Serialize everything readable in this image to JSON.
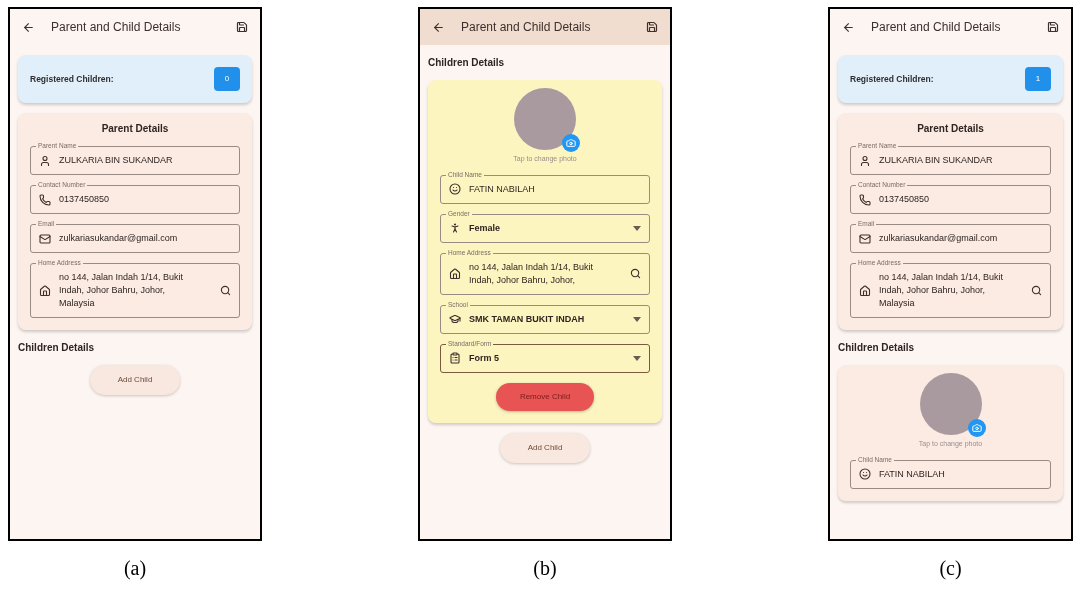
{
  "panels": [
    {
      "caption": "(a)",
      "app_bar": {
        "title": "Parent and Child Details",
        "tinted": false
      },
      "blocks": [
        {
          "kind": "registered",
          "label": "Registered Children:",
          "count": "0"
        },
        {
          "kind": "parent_card",
          "heading": "Parent Details",
          "fields": [
            {
              "kind": "person",
              "label": "Parent Name",
              "value": "ZULKARIA BIN SUKANDAR"
            },
            {
              "kind": "phone",
              "label": "Contact Number",
              "value": "0137450850"
            },
            {
              "kind": "email",
              "label": "Email",
              "value": "zulkariasukandar@gmail.com"
            },
            {
              "kind": "address",
              "label": "Home Address",
              "value": "no 144, Jalan Indah 1/14, Bukit Indah, Johor Bahru, Johor, Malaysia"
            }
          ]
        },
        {
          "kind": "heading",
          "text": "Children Details"
        },
        {
          "kind": "add_button",
          "text": "Add Child"
        }
      ]
    },
    {
      "caption": "(b)",
      "app_bar": {
        "title": "Parent and Child Details",
        "tinted": true
      },
      "blocks": [
        {
          "kind": "heading",
          "text": "Children Details"
        },
        {
          "kind": "child_card",
          "highlighted": true,
          "photo_hint": "Tap to change photo",
          "fields": [
            {
              "kind": "child",
              "label": "Child Name",
              "value": "FATIN NABILAH"
            },
            {
              "kind": "gender",
              "label": "Gender",
              "value": "Female"
            },
            {
              "kind": "address",
              "label": "Home Address",
              "value": "no 144, Jalan Indah 1/14, Bukit Indah, Johor Bahru, Johor,"
            },
            {
              "kind": "school",
              "label": "School",
              "value": "SMK TAMAN BUKIT INDAH"
            },
            {
              "kind": "grade",
              "label": "Standard/Form",
              "value": "Form 5",
              "focused": true
            }
          ],
          "remove_button": "Remove Child"
        },
        {
          "kind": "add_button",
          "text": "Add Child"
        }
      ]
    },
    {
      "caption": "(c)",
      "app_bar": {
        "title": "Parent and Child Details",
        "tinted": false
      },
      "blocks": [
        {
          "kind": "registered",
          "label": "Registered Children:",
          "count": "1"
        },
        {
          "kind": "parent_card",
          "heading": "Parent Details",
          "fields": [
            {
              "kind": "person",
              "label": "Parent Name",
              "value": "ZULKARIA BIN SUKANDAR"
            },
            {
              "kind": "phone",
              "label": "Contact Number",
              "value": "0137450850"
            },
            {
              "kind": "email",
              "label": "Email",
              "value": "zulkariasukandar@gmail.com"
            },
            {
              "kind": "address",
              "label": "Home Address",
              "value": "no 144, Jalan Indah 1/14, Bukit Indah, Johor Bahru, Johor, Malaysia"
            }
          ]
        },
        {
          "kind": "heading",
          "text": "Children Details"
        },
        {
          "kind": "child_card",
          "highlighted": false,
          "photo_hint": "Tap to change photo",
          "fields": [
            {
              "kind": "child",
              "label": "Child Name",
              "value": "FATIN NABILAH"
            }
          ]
        }
      ]
    }
  ]
}
